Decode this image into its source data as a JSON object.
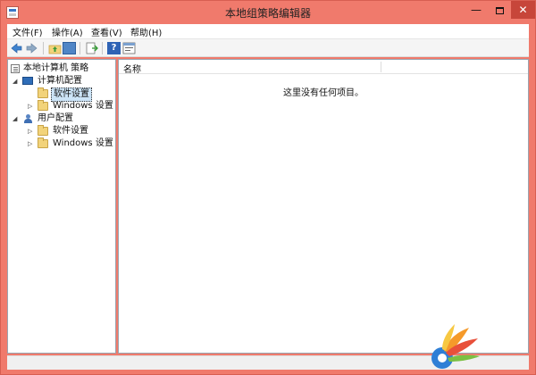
{
  "window": {
    "title": "本地组策略编辑器",
    "controls": {
      "minimize": "—",
      "close": "✕"
    }
  },
  "menu": [
    {
      "label": "文件(F)"
    },
    {
      "label": "操作(A)"
    },
    {
      "label": "查看(V)"
    },
    {
      "label": "帮助(H)"
    }
  ],
  "toolbar": {
    "items": [
      {
        "icon": "back-arrow-icon"
      },
      {
        "icon": "forward-arrow-icon"
      },
      {
        "icon": "up-folder-icon"
      },
      {
        "icon": "show-console-tree-icon"
      },
      {
        "icon": "export-list-icon"
      },
      {
        "icon": "help-icon",
        "glyph": "?"
      },
      {
        "icon": "properties-icon"
      }
    ]
  },
  "tree": {
    "root": "本地计算机 策略",
    "computer_config": {
      "label": "计算机配置",
      "children": [
        "软件设置",
        "Windows 设置"
      ],
      "selected_child": "软件设置"
    },
    "user_config": {
      "label": "用户配置",
      "children": [
        "软件设置",
        "Windows 设置"
      ]
    }
  },
  "list": {
    "column_name": "名称",
    "empty_message": "这里没有任何项目。"
  },
  "colors": {
    "window_frame": "#f07a6c",
    "close_button": "#c7463a",
    "selection": "#cce4f7"
  }
}
